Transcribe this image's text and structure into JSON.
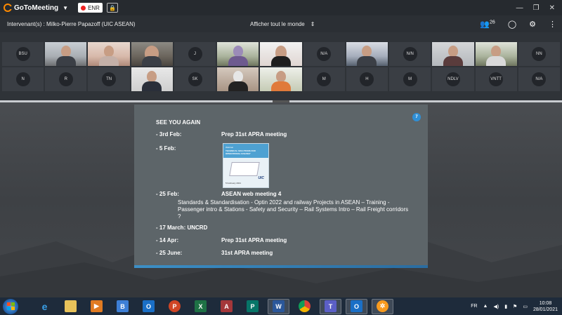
{
  "titlebar": {
    "app_name": "GoToMeeting",
    "record_label": "ENR",
    "colors": {
      "brand": "#ff8a00",
      "record_dot": "#e22222"
    }
  },
  "presenter_bar": {
    "presenter": "Intervenant(s) : Milko-Pierre Papazoff (UIC ASEAN)",
    "view_all": "Afficher tout le monde",
    "participants_count": "26"
  },
  "participants": {
    "row1": [
      "BSU",
      "",
      "",
      "",
      "J",
      "",
      "",
      "N/A",
      "",
      "N/N",
      "",
      "",
      "NN"
    ],
    "row2": [
      "N",
      "R",
      "TN",
      "",
      "SK",
      "",
      "",
      "M",
      "H",
      "M",
      "NDLV",
      "VNTT",
      "N/A"
    ]
  },
  "slide": {
    "number": "7",
    "title": "SEE YOU AGAIN",
    "items": [
      {
        "date": "- 3rd Feb:",
        "text": "Prep 31st APRA meeting"
      },
      {
        "date": "- 5 Feb:",
        "text": ""
      },
      {
        "date": "- 25 Feb:",
        "text": "ASEAN web meeting 4"
      },
      {
        "date": "- 17 March: UNCRD",
        "text": ""
      },
      {
        "date": "- 14 Apr:",
        "text": "Prep 31st APRA meeting"
      },
      {
        "date": "- 25 June:",
        "text": "31st APRA meeting"
      }
    ],
    "details": "Standards & Standardisation - Optin 2022 and railway Projects    in ASEAN – Training - Passenger intro & Stations - Safety and            Security – Rail Systems Intro – Rail Freight corridors ?",
    "webinar": {
      "kicker": "Webinar",
      "title": "TECHNICAL SOLUTIONS FOR OPERATIONAL RAILWAY",
      "date": "5 February 2021",
      "logo": "UIC"
    }
  },
  "taskbar": {
    "apps": [
      "ie-icon",
      "file-explorer-icon",
      "media-player-icon",
      "b-app-icon",
      "outlook-icon",
      "powerpoint-icon",
      "excel-icon",
      "access-icon",
      "publisher-icon",
      "word-icon",
      "chrome-icon",
      "teams-icon",
      "outlook-icon",
      "gotomeeting-icon"
    ],
    "language": "FR",
    "time": "10:08",
    "date": "28/01/2021"
  }
}
